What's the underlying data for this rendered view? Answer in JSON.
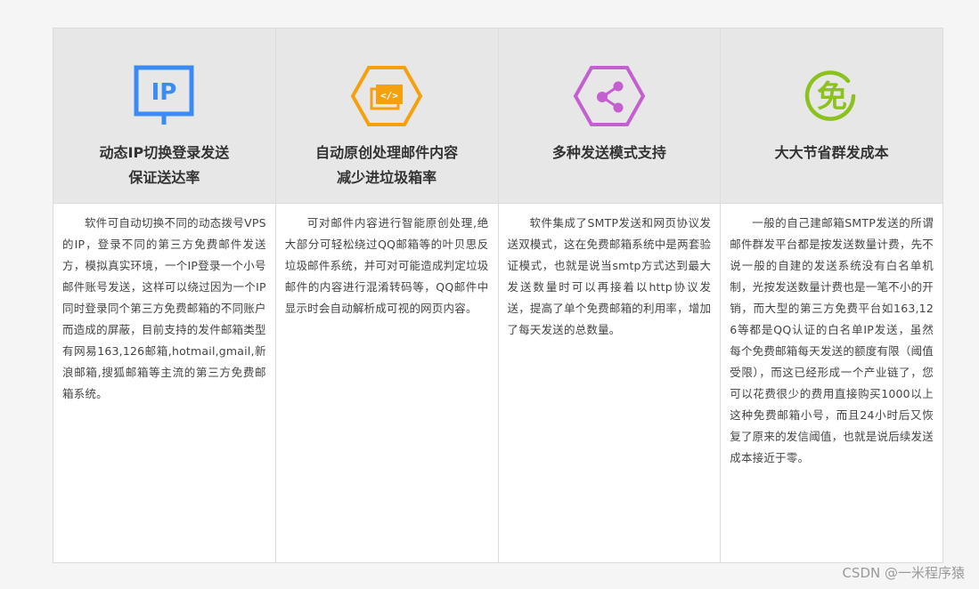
{
  "features": [
    {
      "icon": "ip-monitor-icon",
      "icon_color": "#3b8bf5",
      "icon_text": "IP",
      "title_lines": [
        "动态IP切换登录发送",
        "保证送达率"
      ],
      "body": "软件可自动切换不同的动态拨号VPS的IP，登录不同的第三方免费邮件发送方，模拟真实环境，一个IP登录一个小号邮件账号发送，这样可以绕过因为一个IP同时登录同个第三方免费邮箱的不同账户而造成的屏蔽，目前支持的发件邮箱类型有网易163,126邮箱,hotmail,gmail,新浪邮箱,搜狐邮箱等主流的第三方免费邮箱系统。"
    },
    {
      "icon": "code-hexagon-icon",
      "icon_color": "#f5a00e",
      "title_lines": [
        "自动原创处理邮件内容",
        "减少进垃圾箱率"
      ],
      "body": "可对邮件内容进行智能原创处理,绝大部分可轻松绕过QQ邮箱等的叶贝思反垃圾邮件系统，并可对可能造成判定垃圾邮件的内容进行混淆转码等，QQ邮件中显示时会自动解析成可视的网页内容。"
    },
    {
      "icon": "share-hexagon-icon",
      "icon_color": "#c45fd2",
      "title_lines": [
        "多种发送模式支持"
      ],
      "body": "软件集成了SMTP发送和网页协议发送双模式，这在免费邮箱系统中是两套验证模式，也就是说当smtp方式达到最大发送数量时可以再接着以http协议发送，提高了单个免费邮箱的利用率，增加了每天发送的总数量。"
    },
    {
      "icon": "free-badge-icon",
      "icon_color": "#8cc21d",
      "icon_text": "免",
      "title_lines": [
        "大大节省群发成本"
      ],
      "body": "一般的自己建邮箱SMTP发送的所谓邮件群发平台都是按发送数量计费，先不说一般的自建的发送系统没有白名单机制，光按发送数量计费也是一笔不小的开销，而大型的第三方免费平台如163,126等都是QQ认证的白名单IP发送，虽然每个免费邮箱每天发送的额度有限（阈值受限），而这已经形成一个产业链了，您可以花费很少的费用直接购买1000以上这种免费邮箱小号，而且24小时后又恢复了原来的发信阈值，也就是说后续发送成本接近于零。"
    }
  ],
  "watermark": "CSDN @一米程序猿"
}
